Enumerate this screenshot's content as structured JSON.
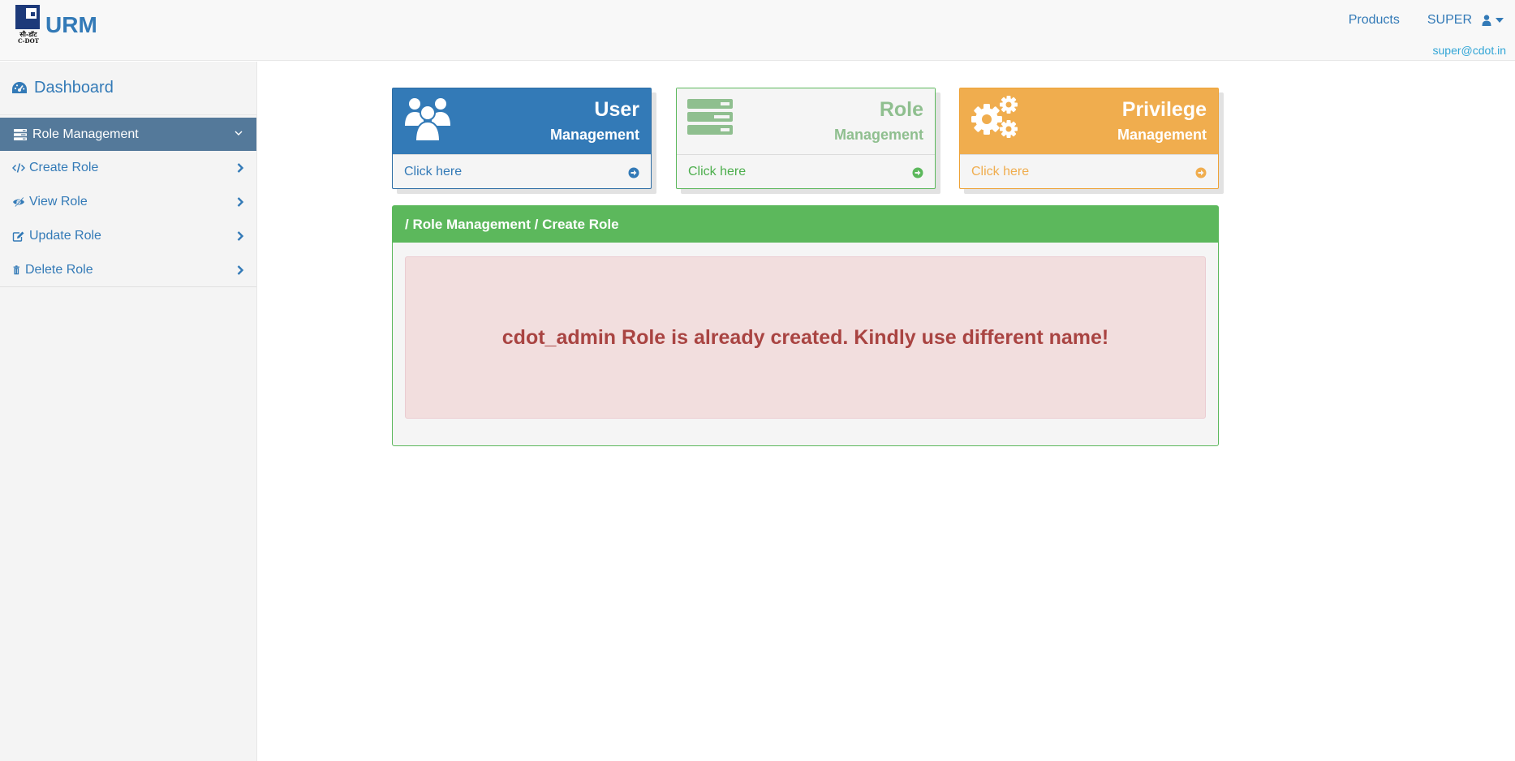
{
  "brand": {
    "logo_text_hindi": "सी-डॉट",
    "logo_text_english": "C-DOT",
    "name": "URM"
  },
  "navbar": {
    "products_label": "Products",
    "user_label": "SUPER",
    "email": "super@cdot.in"
  },
  "sidebar": {
    "dashboard_label": "Dashboard",
    "section_label": "Role Management",
    "items": [
      {
        "label": "Create Role",
        "icon": "code-icon"
      },
      {
        "label": "View Role",
        "icon": "eye-icon"
      },
      {
        "label": "Update Role",
        "icon": "edit-icon"
      },
      {
        "label": "Delete Role",
        "icon": "trash-icon"
      }
    ]
  },
  "cards": [
    {
      "title": "User",
      "subtitle": "Management",
      "link_label": "Click here",
      "icon": "users-icon",
      "color": "#337ab7"
    },
    {
      "title": "Role",
      "subtitle": "Management",
      "link_label": "Click here",
      "icon": "server-icon",
      "color": "#5cb85c"
    },
    {
      "title": "Privilege",
      "subtitle": "Management",
      "link_label": "Click here",
      "icon": "gears-icon",
      "color": "#f0ad4e"
    }
  ],
  "panel": {
    "breadcrumb": "/ Role Management / Create Role",
    "alert_message": "cdot_admin Role is already created. Kindly use different name!"
  },
  "colors": {
    "primary": "#337ab7",
    "success": "#5cb85c",
    "warning": "#f0ad4e",
    "danger_text": "#a94442",
    "danger_bg": "#f2dede",
    "sidebar_active": "#54799a"
  }
}
